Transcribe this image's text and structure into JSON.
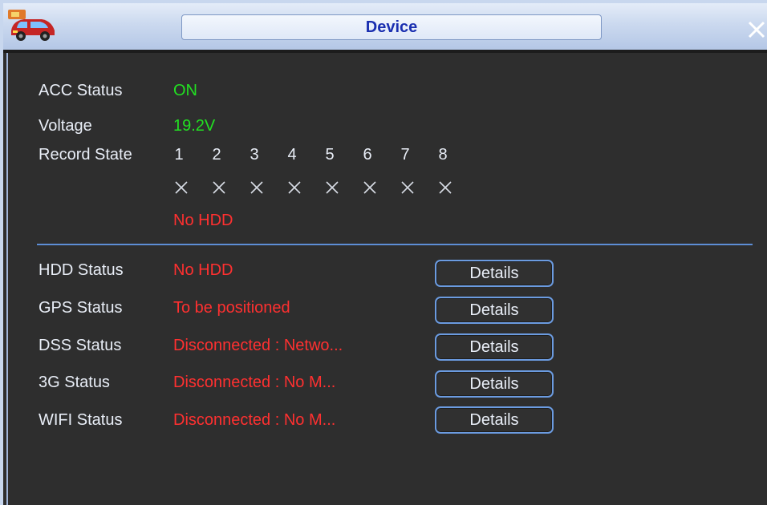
{
  "window": {
    "title": "Device",
    "close_symbol": "×",
    "logo_icon": "car-icon",
    "colors": {
      "background": "#2e2e2e",
      "titlebar": "#cbd9ef",
      "title_text": "#1a2fb0",
      "label": "#e9eef7",
      "ok": "#22e022",
      "error": "#ff3030",
      "accent": "#6b9be0"
    }
  },
  "acc": {
    "label": "ACC Status",
    "value": "ON"
  },
  "voltage": {
    "label": "Voltage",
    "value": "19.2V"
  },
  "record": {
    "label": "Record State",
    "channels": [
      "1",
      "2",
      "3",
      "4",
      "5",
      "6",
      "7",
      "8"
    ],
    "channel_state_icon": "x-mark-icon",
    "message": "No HDD"
  },
  "status_rows": [
    {
      "label": "HDD Status",
      "value": "No HDD",
      "button": "Details"
    },
    {
      "label": "GPS Status",
      "value": "To be positioned",
      "button": "Details"
    },
    {
      "label": "DSS Status",
      "value": "Disconnected : Netwo...",
      "button": "Details"
    },
    {
      "label": "3G Status",
      "value": "Disconnected : No M...",
      "button": "Details"
    },
    {
      "label": "WIFI Status",
      "value": "Disconnected : No M...",
      "button": "Details"
    }
  ]
}
